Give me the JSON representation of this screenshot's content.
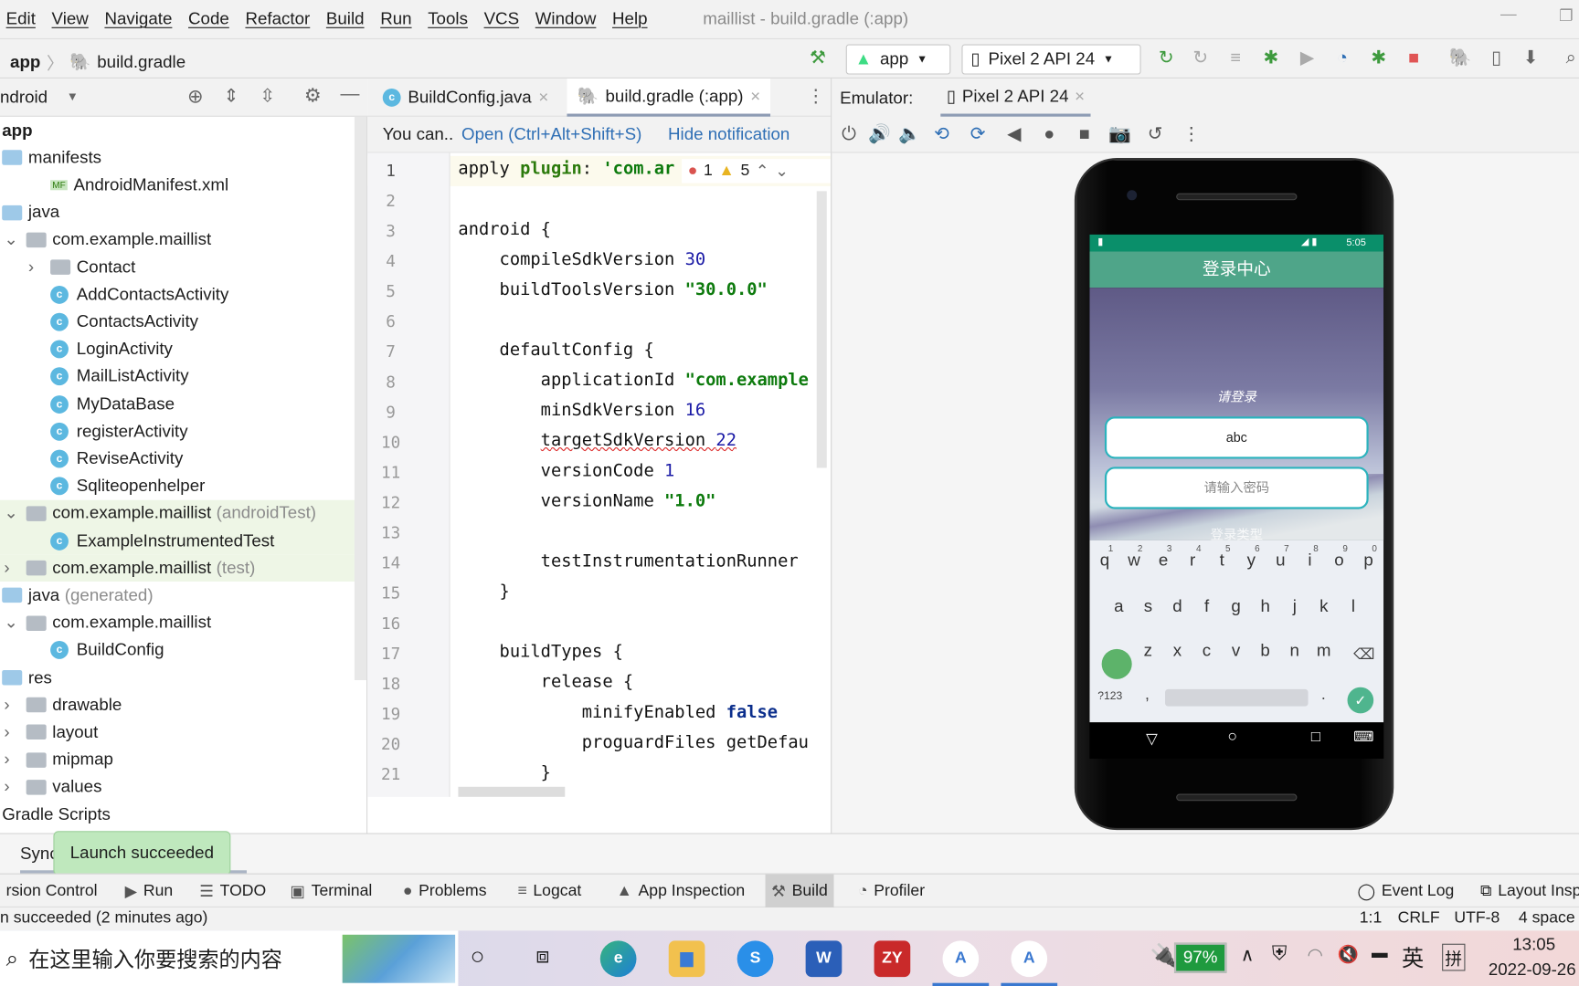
{
  "menu": [
    "Edit",
    "View",
    "Navigate",
    "Code",
    "Refactor",
    "Build",
    "Run",
    "Tools",
    "VCS",
    "Window",
    "Help"
  ],
  "window_title": "maillist - build.gradle (:app)",
  "breadcrumb": {
    "module": "app",
    "file": "build.gradle"
  },
  "toolbar": {
    "run_config": "app",
    "device": "Pixel 2 API 24"
  },
  "project": {
    "view": "ndroid",
    "rows": [
      {
        "label": "app",
        "depth": 0,
        "kind": "bold"
      },
      {
        "label": "manifests",
        "depth": 0,
        "kind": "folder"
      },
      {
        "label": "AndroidManifest.xml",
        "depth": 2,
        "kind": "manifest"
      },
      {
        "label": "java",
        "depth": 0,
        "kind": "folder"
      },
      {
        "label": "com.example.maillist",
        "depth": 1,
        "kind": "pkg",
        "arrow": "down"
      },
      {
        "label": "Contact",
        "depth": 2,
        "kind": "pkg",
        "arrow": "right"
      },
      {
        "label": "AddContactsActivity",
        "depth": 2,
        "kind": "class"
      },
      {
        "label": "ContactsActivity",
        "depth": 2,
        "kind": "class"
      },
      {
        "label": "LoginActivity",
        "depth": 2,
        "kind": "class"
      },
      {
        "label": "MailListActivity",
        "depth": 2,
        "kind": "class"
      },
      {
        "label": "MyDataBase",
        "depth": 2,
        "kind": "class"
      },
      {
        "label": "registerActivity",
        "depth": 2,
        "kind": "class"
      },
      {
        "label": "ReviseActivity",
        "depth": 2,
        "kind": "class"
      },
      {
        "label": "Sqliteopenhelper",
        "depth": 2,
        "kind": "class"
      },
      {
        "label": "com.example.maillist",
        "suffix": "(androidTest)",
        "depth": 1,
        "kind": "pkg",
        "arrow": "down",
        "hl": true
      },
      {
        "label": "ExampleInstrumentedTest",
        "depth": 2,
        "kind": "class",
        "hl": true
      },
      {
        "label": "com.example.maillist",
        "suffix": "(test)",
        "depth": 1,
        "kind": "pkg",
        "arrow": "right",
        "hl": true
      },
      {
        "label": "java",
        "suffix": "(generated)",
        "depth": 0,
        "kind": "folder"
      },
      {
        "label": "com.example.maillist",
        "depth": 1,
        "kind": "pkg",
        "arrow": "down"
      },
      {
        "label": "BuildConfig",
        "depth": 2,
        "kind": "class"
      },
      {
        "label": "res",
        "depth": 0,
        "kind": "folder"
      },
      {
        "label": "drawable",
        "depth": 1,
        "kind": "pkg",
        "arrow": "right"
      },
      {
        "label": "layout",
        "depth": 1,
        "kind": "pkg",
        "arrow": "right"
      },
      {
        "label": "mipmap",
        "depth": 1,
        "kind": "pkg",
        "arrow": "right"
      },
      {
        "label": "values",
        "depth": 1,
        "kind": "pkg",
        "arrow": "right"
      },
      {
        "label": "Gradle Scripts",
        "depth": 0,
        "kind": "plain"
      }
    ]
  },
  "editor": {
    "tabs": [
      {
        "label": "BuildConfig.java",
        "active": false
      },
      {
        "label": "build.gradle (:app)",
        "active": true
      }
    ],
    "notification": {
      "text": "You can..",
      "open": "Open (Ctrl+Alt+Shift+S)",
      "hide": "Hide notification"
    },
    "inspections": {
      "errors": "1",
      "warnings": "5"
    },
    "lines": [
      [
        [
          "apply ",
          ""
        ],
        [
          "plugin",
          "k-id"
        ],
        [
          ": ",
          ""
        ],
        [
          "'com.ar",
          "k-str"
        ]
      ],
      [],
      [
        [
          "android {",
          ""
        ]
      ],
      [
        [
          "    compileSdkVersion ",
          ""
        ],
        [
          "30",
          "k-num"
        ]
      ],
      [
        [
          "    buildToolsVersion ",
          ""
        ],
        [
          "\"30.0.0\"",
          "k-str"
        ]
      ],
      [],
      [
        [
          "    defaultConfig {",
          ""
        ]
      ],
      [
        [
          "        applicationId ",
          ""
        ],
        [
          "\"com.example",
          "k-str"
        ]
      ],
      [
        [
          "        minSdkVersion ",
          ""
        ],
        [
          "16",
          "k-num"
        ]
      ],
      [
        [
          "        ",
          ""
        ],
        [
          "targetSdkVersion ",
          "k-err"
        ],
        [
          "22",
          "k-num k-err"
        ]
      ],
      [
        [
          "        versionCode ",
          ""
        ],
        [
          "1",
          "k-num"
        ]
      ],
      [
        [
          "        versionName ",
          ""
        ],
        [
          "\"1.0\"",
          "k-str"
        ]
      ],
      [],
      [
        [
          "        testInstrumentationRunner",
          ""
        ]
      ],
      [
        [
          "    }",
          ""
        ]
      ],
      [],
      [
        [
          "    buildTypes {",
          ""
        ]
      ],
      [
        [
          "        release {",
          ""
        ]
      ],
      [
        [
          "            minifyEnabled ",
          ""
        ],
        [
          "false",
          "k-kw"
        ]
      ],
      [
        [
          "            proguardFiles getDefau",
          ""
        ]
      ],
      [
        [
          "        }",
          ""
        ]
      ]
    ]
  },
  "emulator": {
    "label": "Emulator:",
    "tab": "Pixel 2 API 24",
    "phone": {
      "time": "5:05",
      "app_title": "登录中心",
      "prompt": "请登录",
      "username": "abc",
      "password_placeholder": "请输入密码",
      "login_type": "登录类型",
      "keys_row1": [
        "q",
        "w",
        "e",
        "r",
        "t",
        "y",
        "u",
        "i",
        "o",
        "p"
      ],
      "digits": [
        "1",
        "2",
        "3",
        "4",
        "5",
        "6",
        "7",
        "8",
        "9",
        "0"
      ],
      "keys_row2": [
        "a",
        "s",
        "d",
        "f",
        "g",
        "h",
        "j",
        "k",
        "l"
      ],
      "keys_row3": [
        "z",
        "x",
        "c",
        "v",
        "b",
        "n",
        "m"
      ],
      "sym_key": "?123",
      "comma": ",",
      "period": "."
    }
  },
  "sync_tab": "Sync",
  "toast": "Launch succeeded",
  "tool_windows": [
    "rsion Control",
    "Run",
    "TODO",
    "Terminal",
    "Problems",
    "Logcat",
    "App Inspection",
    "Build",
    "Profiler"
  ],
  "tool_windows_right": [
    "Event Log",
    "Layout Insp"
  ],
  "status": {
    "message": "n succeeded (2 minutes ago)",
    "position": "1:1",
    "line_sep": "CRLF",
    "encoding": "UTF-8",
    "indent": "4 space"
  },
  "taskbar": {
    "search_placeholder": "在这里输入你要搜索的内容",
    "battery": "97%",
    "ime": "英",
    "ime2": "拼",
    "time": "13:05",
    "date": "2022-09-26"
  },
  "colors": {
    "accent": "#2bb3bd",
    "appbar": "#4fa589",
    "statusbar": "#0a8f6a",
    "toast": "#bfe8bd"
  }
}
